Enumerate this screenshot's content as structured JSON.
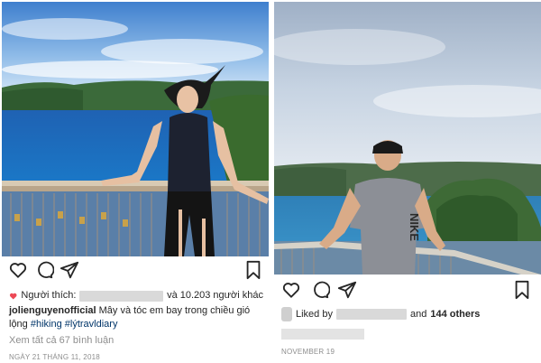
{
  "left_post": {
    "likes_prefix": "Người thích:",
    "likes_suffix": "và 10.203 người khác",
    "caption_user": "jolienguyenofficial",
    "caption_text": "Mây và tóc em bay trong chiều gió lộng",
    "hashtag_1": "#hiking",
    "hashtag_2": "#lýtravldiary",
    "view_comments": "Xem tất cả 67 bình luận",
    "date": "NGÀY 21 THÁNG 11, 2018"
  },
  "right_post": {
    "likes_prefix": "Liked by",
    "likes_and": "and",
    "likes_count": "144 others",
    "date": "NOVEMBER 19",
    "shirt_text": "NIKE"
  },
  "icons": [
    "heart-icon",
    "comment-icon",
    "share-icon",
    "bookmark-icon"
  ],
  "colors": {
    "text": "#262626",
    "hashtag": "#003569",
    "muted": "#8e8e8e",
    "like_red": "#ed4956"
  }
}
